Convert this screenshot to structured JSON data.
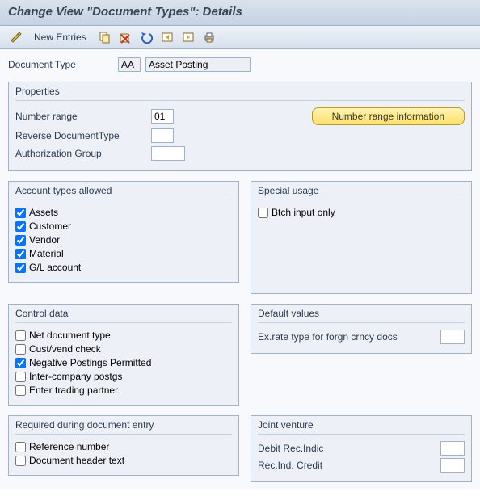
{
  "title": "Change View \"Document Types\": Details",
  "toolbar": {
    "new_entries": "New Entries"
  },
  "doc_type": {
    "label": "Document Type",
    "code": "AA",
    "desc": "Asset Posting"
  },
  "properties": {
    "legend": "Properties",
    "number_range_label": "Number range",
    "number_range_value": "01",
    "reverse_doctype_label": "Reverse DocumentType",
    "reverse_doctype_value": "",
    "auth_group_label": "Authorization Group",
    "auth_group_value": "",
    "nr_info_button": "Number range information"
  },
  "account_types": {
    "legend": "Account types allowed",
    "items": [
      {
        "label": "Assets",
        "checked": true
      },
      {
        "label": "Customer",
        "checked": true
      },
      {
        "label": "Vendor",
        "checked": true
      },
      {
        "label": "Material",
        "checked": true
      },
      {
        "label": "G/L account",
        "checked": true
      }
    ]
  },
  "special_usage": {
    "legend": "Special usage",
    "items": [
      {
        "label": "Btch input only",
        "checked": false
      }
    ]
  },
  "control_data": {
    "legend": "Control data",
    "items": [
      {
        "label": "Net document type",
        "checked": false
      },
      {
        "label": "Cust/vend check",
        "checked": false
      },
      {
        "label": "Negative Postings Permitted",
        "checked": true
      },
      {
        "label": "Inter-company postgs",
        "checked": false
      },
      {
        "label": "Enter trading partner",
        "checked": false
      }
    ]
  },
  "default_values": {
    "legend": "Default values",
    "ex_rate_label": "Ex.rate type for forgn crncy docs",
    "ex_rate_value": ""
  },
  "required_entry": {
    "legend": "Required during document entry",
    "items": [
      {
        "label": "Reference number",
        "checked": false
      },
      {
        "label": "Document header text",
        "checked": false
      }
    ]
  },
  "joint_venture": {
    "legend": "Joint venture",
    "debit_label": "Debit Rec.Indic",
    "debit_value": "",
    "credit_label": "Rec.Ind. Credit",
    "credit_value": ""
  }
}
